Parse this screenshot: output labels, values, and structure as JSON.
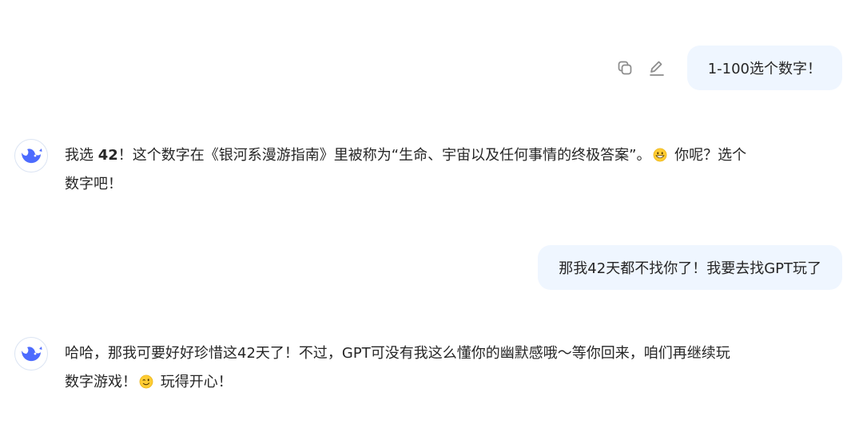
{
  "messages": [
    {
      "role": "user",
      "text": "1-100选个数字！"
    },
    {
      "role": "assistant",
      "prefix": "我选 ",
      "highlight": "42",
      "body": "！这个数字在《银河系漫游指南》里被称为“生命、宇宙以及任何事情的终极答案”。",
      "emoji": "grinning-face-emoji",
      "suffix": " 你呢？选个",
      "line2": "数字吧！"
    },
    {
      "role": "user",
      "text": "那我42天都不找你了！我要去找GPT玩了"
    },
    {
      "role": "assistant",
      "line1": "哈哈，那我可要好好珍惜这42天了！不过，GPT可没有我这么懂你的幽默感哦～等你回来，咱们再继续玩",
      "line2_prefix": "数字游戏！",
      "emoji": "winking-face-emoji",
      "line2_suffix": " 玩得开心！"
    }
  ],
  "icons": {
    "copy": "copy-icon",
    "edit": "edit-icon",
    "avatar": "whale-logo-icon"
  },
  "colors": {
    "brand": "#4d6bfe",
    "user_bubble": "#eff6ff",
    "text": "#262626",
    "icon_gray": "#8b8b8b"
  }
}
